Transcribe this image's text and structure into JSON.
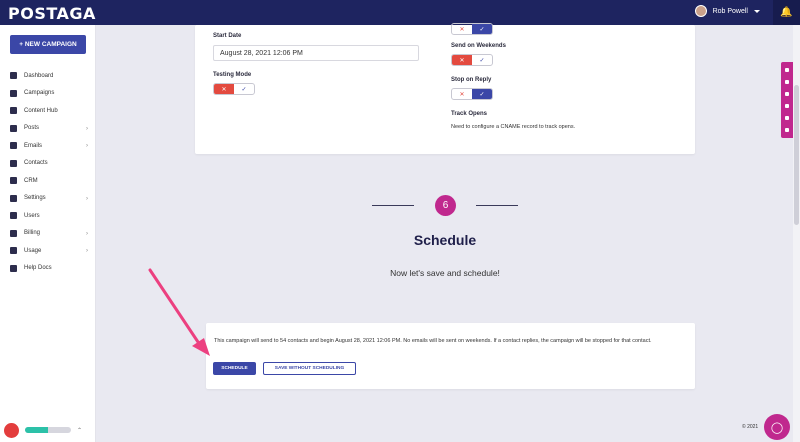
{
  "header": {
    "logo": "POSTAGA",
    "user_name": "Rob Powell"
  },
  "sidebar": {
    "new_campaign": "+ NEW CAMPAIGN",
    "items": [
      {
        "label": "Dashboard",
        "icon": "dashboard-icon",
        "expandable": false
      },
      {
        "label": "Campaigns",
        "icon": "campaigns-icon",
        "expandable": false
      },
      {
        "label": "Content Hub",
        "icon": "content-hub-icon",
        "expandable": false
      },
      {
        "label": "Posts",
        "icon": "pin-icon",
        "expandable": true
      },
      {
        "label": "Emails",
        "icon": "envelope-icon",
        "expandable": true
      },
      {
        "label": "Contacts",
        "icon": "contacts-icon",
        "expandable": false
      },
      {
        "label": "CRM",
        "icon": "handshake-icon",
        "expandable": false
      },
      {
        "label": "Settings",
        "icon": "gear-icon",
        "expandable": true
      },
      {
        "label": "Users",
        "icon": "users-icon",
        "expandable": false
      },
      {
        "label": "Billing",
        "icon": "dollar-icon",
        "expandable": true
      },
      {
        "label": "Usage",
        "icon": "usage-icon",
        "expandable": true
      },
      {
        "label": "Help Docs",
        "icon": "help-icon",
        "expandable": false
      }
    ],
    "usage_progress": 0.5
  },
  "settings_card": {
    "start_date_label": "Start Date",
    "start_date_value": "August 28, 2021 12:06 PM",
    "testing_mode_label": "Testing Mode",
    "send_weekends_label": "Send on Weekends",
    "stop_reply_label": "Stop on Reply",
    "track_opens_label": "Track Opens",
    "track_opens_note": "Need to configure a CNAME record to track opens.",
    "toggle_off_glyph": "✕",
    "toggle_on_glyph": "✓"
  },
  "step": {
    "number": "6",
    "title": "Schedule",
    "subtitle": "Now let's save and schedule!"
  },
  "summary_card": {
    "text": "This campaign will send to 54 contacts and begin August 28, 2021 12:06 PM. No emails will be sent on weekends. If a contact replies, the campaign will be stopped for that contact.",
    "schedule_button": "SCHEDULE",
    "save_button": "SAVE WITHOUT SCHEDULING"
  },
  "footer": {
    "copyright": "© 2021"
  },
  "colors": {
    "navy": "#1e2460",
    "primary": "#3b47a7",
    "magenta": "#c0288e",
    "red": "#e34a3f"
  }
}
